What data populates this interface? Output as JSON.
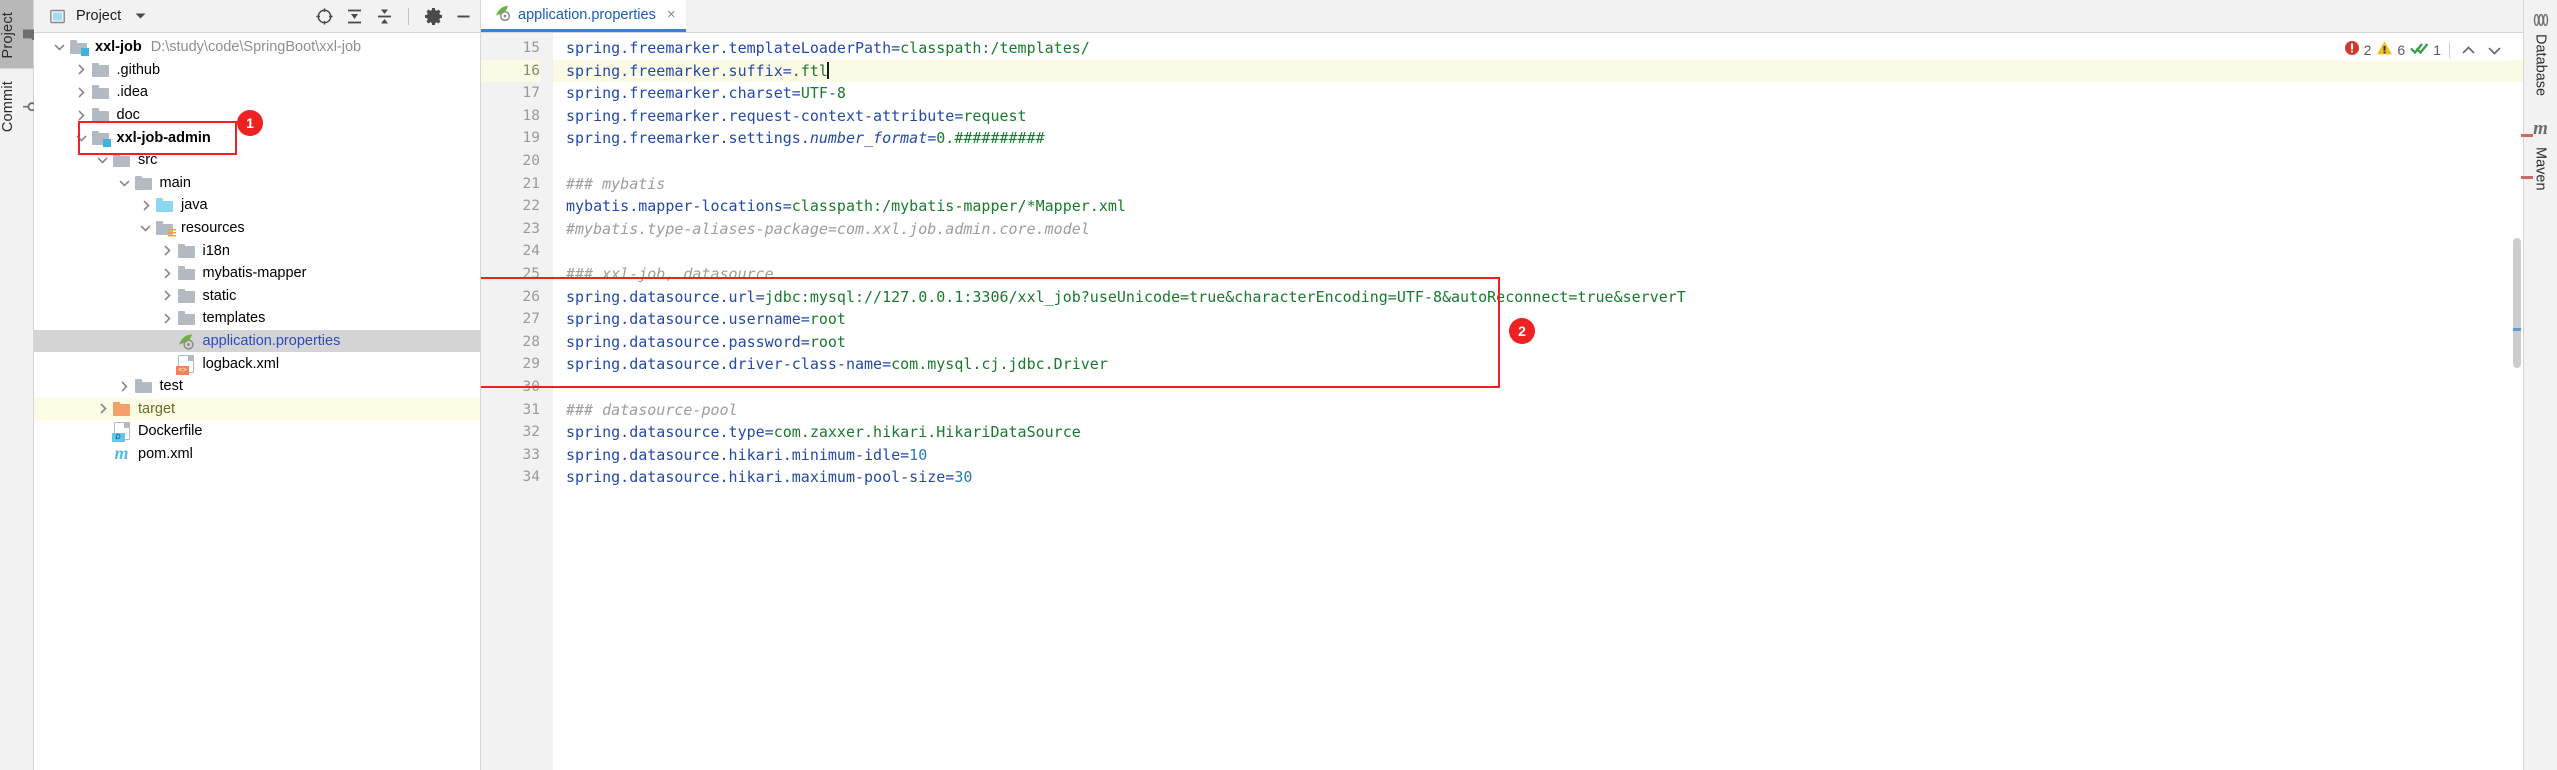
{
  "left_rail": [
    {
      "label": "Project",
      "icon": "folder-icon",
      "active": true
    },
    {
      "label": "Commit",
      "icon": "commit-icon",
      "active": false
    }
  ],
  "right_rail": [
    {
      "label": "Database",
      "icon": "database-icon"
    },
    {
      "label": "Maven",
      "icon": "maven-icon"
    }
  ],
  "project_panel": {
    "title": "Project",
    "title_chevron": "chevron-down-icon",
    "toolbar": [
      {
        "name": "select-opened-file-icon",
        "tooltip": "Select Opened File"
      },
      {
        "name": "expand-all-icon",
        "tooltip": "Expand All"
      },
      {
        "name": "collapse-all-icon",
        "tooltip": "Collapse All"
      },
      {
        "name": "settings-gear-icon",
        "tooltip": "Settings"
      },
      {
        "name": "hide-icon",
        "tooltip": "Hide"
      }
    ],
    "tree": [
      {
        "label": "xxl-job",
        "hint": "D:\\study\\code\\SpringBoot\\xxl-job",
        "indent": 0,
        "arrow": "down",
        "icon": "module-folder",
        "bold": true
      },
      {
        "label": ".github",
        "hint": "",
        "indent": 1,
        "arrow": "right",
        "icon": "folder"
      },
      {
        "label": ".idea",
        "hint": "",
        "indent": 1,
        "arrow": "right",
        "icon": "folder"
      },
      {
        "label": "doc",
        "hint": "",
        "indent": 1,
        "arrow": "right",
        "icon": "folder"
      },
      {
        "label": "xxl-job-admin",
        "hint": "",
        "indent": 1,
        "arrow": "down",
        "icon": "module-folder",
        "bold": true
      },
      {
        "label": "src",
        "hint": "",
        "indent": 2,
        "arrow": "down",
        "icon": "folder"
      },
      {
        "label": "main",
        "hint": "",
        "indent": 3,
        "arrow": "down",
        "icon": "folder"
      },
      {
        "label": "java",
        "hint": "",
        "indent": 4,
        "arrow": "right",
        "icon": "source-folder"
      },
      {
        "label": "resources",
        "hint": "",
        "indent": 4,
        "arrow": "down",
        "icon": "resources-folder"
      },
      {
        "label": "i18n",
        "hint": "",
        "indent": 5,
        "arrow": "right",
        "icon": "folder"
      },
      {
        "label": "mybatis-mapper",
        "hint": "",
        "indent": 5,
        "arrow": "right",
        "icon": "folder"
      },
      {
        "label": "static",
        "hint": "",
        "indent": 5,
        "arrow": "right",
        "icon": "folder"
      },
      {
        "label": "templates",
        "hint": "",
        "indent": 5,
        "arrow": "right",
        "icon": "folder"
      },
      {
        "label": "application.properties",
        "hint": "",
        "indent": 5,
        "arrow": "none",
        "icon": "spring-file",
        "selected": true,
        "blue": true
      },
      {
        "label": "logback.xml",
        "hint": "",
        "indent": 5,
        "arrow": "none",
        "icon": "xml-file"
      },
      {
        "label": "test",
        "hint": "",
        "indent": 3,
        "arrow": "right",
        "icon": "folder"
      },
      {
        "label": "target",
        "hint": "",
        "indent": 2,
        "arrow": "right",
        "icon": "target-folder",
        "highlight": true,
        "olive": true
      },
      {
        "label": "Dockerfile",
        "hint": "",
        "indent": 2,
        "arrow": "none",
        "icon": "docker-file"
      },
      {
        "label": "pom.xml",
        "hint": "",
        "indent": 2,
        "arrow": "none",
        "icon": "maven-file"
      }
    ]
  },
  "editor": {
    "tab": {
      "label": "application.properties",
      "icon": "spring-file-icon",
      "close": "×"
    },
    "first_line_number": 15,
    "current_line": 16,
    "inspections": {
      "error_icon": "error-icon",
      "error_count": "2",
      "warning_icon": "warning-icon",
      "warning_count": "6",
      "ok_icon": "inspection-ok-icon",
      "ok_count": "1",
      "prev_icon": "chevron-up-icon",
      "next_icon": "chevron-down-icon"
    },
    "lines": [
      {
        "n": 15,
        "tokens": [
          {
            "t": "spring.freemarker.templateLoaderPath=",
            "c": "k"
          },
          {
            "t": "classpath:/templates/",
            "c": "v"
          }
        ]
      },
      {
        "n": 16,
        "tokens": [
          {
            "t": "spring.freemarker.suffix=",
            "c": "k"
          },
          {
            "t": ".ftl",
            "c": "v"
          }
        ],
        "caret": true
      },
      {
        "n": 17,
        "tokens": [
          {
            "t": "spring.freemarker.charset=",
            "c": "k"
          },
          {
            "t": "UTF-8",
            "c": "v"
          }
        ]
      },
      {
        "n": 18,
        "tokens": [
          {
            "t": "spring.freemarker.request-context-attribute=",
            "c": "k"
          },
          {
            "t": "request",
            "c": "v"
          }
        ]
      },
      {
        "n": 19,
        "tokens": [
          {
            "t": "spring.freemarker.settings.",
            "c": "k"
          },
          {
            "t": "number_format",
            "c": "it"
          },
          {
            "t": "=",
            "c": "k"
          },
          {
            "t": "0.##########",
            "c": "v"
          }
        ]
      },
      {
        "n": 20,
        "tokens": []
      },
      {
        "n": 21,
        "tokens": [
          {
            "t": "### mybatis",
            "c": "cm"
          }
        ]
      },
      {
        "n": 22,
        "tokens": [
          {
            "t": "mybatis.mapper-locations=",
            "c": "k"
          },
          {
            "t": "classpath:/mybatis-mapper/*Mapper.xml",
            "c": "v"
          }
        ]
      },
      {
        "n": 23,
        "tokens": [
          {
            "t": "#mybatis.type-aliases-package=com.xxl.job.admin.core.model",
            "c": "cm"
          }
        ]
      },
      {
        "n": 24,
        "tokens": []
      },
      {
        "n": 25,
        "tokens": [
          {
            "t": "### xxl-job, datasource",
            "c": "cm"
          }
        ]
      },
      {
        "n": 26,
        "tokens": [
          {
            "t": "spring.datasource.url=",
            "c": "k"
          },
          {
            "t": "jdbc:mysql://127.0.0.1:3306/xxl_job?useUnicode=true&characterEncoding=UTF-8&autoReconnect=true&serverT",
            "c": "v"
          }
        ]
      },
      {
        "n": 27,
        "tokens": [
          {
            "t": "spring.datasource.username=",
            "c": "k"
          },
          {
            "t": "root",
            "c": "v"
          }
        ]
      },
      {
        "n": 28,
        "tokens": [
          {
            "t": "spring.datasource.password=",
            "c": "k"
          },
          {
            "t": "root",
            "c": "v"
          }
        ]
      },
      {
        "n": 29,
        "tokens": [
          {
            "t": "spring.datasource.driver-class-name=",
            "c": "k"
          },
          {
            "t": "com.mysql.cj.jdbc.Driver",
            "c": "v"
          }
        ]
      },
      {
        "n": 30,
        "tokens": []
      },
      {
        "n": 31,
        "tokens": [
          {
            "t": "### datasource-pool",
            "c": "cm"
          }
        ]
      },
      {
        "n": 32,
        "tokens": [
          {
            "t": "spring.datasource.type=",
            "c": "k"
          },
          {
            "t": "com.zaxxer.hikari.HikariDataSource",
            "c": "v"
          }
        ]
      },
      {
        "n": 33,
        "tokens": [
          {
            "t": "spring.datasource.hikari.minimum-idle=",
            "c": "k"
          },
          {
            "t": "10",
            "c": "num"
          }
        ]
      },
      {
        "n": 34,
        "tokens": [
          {
            "t": "spring.datasource.hikari.maximum-pool-size=",
            "c": "k"
          },
          {
            "t": "30",
            "c": "num"
          }
        ]
      }
    ]
  },
  "annotations": [
    {
      "number": "1",
      "target": "xxl-job-admin-tree-row"
    },
    {
      "number": "2",
      "target": "datasource-code-block"
    }
  ],
  "colors": {
    "accent_blue": "#3d7fd1",
    "annotation_red": "#ee2222",
    "key_blue": "#2449a8",
    "value_green": "#1a7a2e",
    "comment_gray": "#9d9d9d",
    "selection_gray": "#d4d4d4",
    "current_line_yellow": "#fbfae5"
  }
}
